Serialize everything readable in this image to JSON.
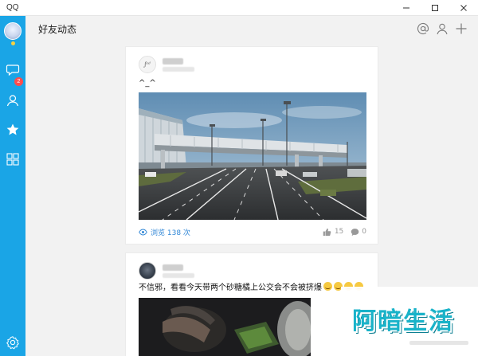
{
  "window": {
    "app_label": "QQ"
  },
  "sidebar": {
    "badge_count": "2",
    "items": [
      {
        "name": "messages",
        "icon": "chat-bubble-icon"
      },
      {
        "name": "contacts",
        "icon": "person-icon"
      },
      {
        "name": "favorites",
        "icon": "star-icon",
        "active": true
      },
      {
        "name": "apps",
        "icon": "grid-icon"
      },
      {
        "name": "settings",
        "icon": "gear-icon"
      }
    ]
  },
  "header": {
    "title": "好友动态",
    "actions": [
      "at-icon",
      "person-icon",
      "plus-icon"
    ]
  },
  "feed": {
    "posts": [
      {
        "avatar_text": "ʃᵃᵈ",
        "text": "^_^",
        "views_label": "浏览 138 次",
        "likes": "15",
        "comments": "0"
      },
      {
        "text": "不信邪，看看今天带两个砂糖橘上公交会不会被挤爆"
      }
    ]
  },
  "watermark": {
    "text": "阿暗生活"
  },
  "colors": {
    "sidebar": "#1aa5e6",
    "accent": "#2f86d6",
    "badge": "#ff4d4d",
    "watermark": "#19b3c9"
  }
}
